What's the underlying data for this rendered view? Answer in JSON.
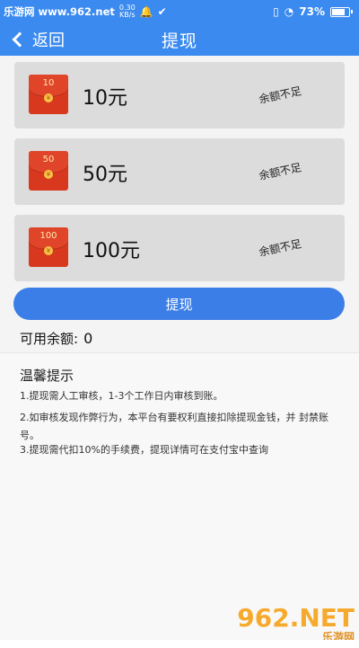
{
  "status_bar": {
    "watermark": "乐游网 www.962.net",
    "speed_value": "0.30",
    "speed_unit": "KB/s",
    "battery": "73%"
  },
  "header": {
    "back_label": "返回",
    "title": "提现"
  },
  "options": [
    {
      "packet_value": "10",
      "amount": "10元",
      "status": "余额不足"
    },
    {
      "packet_value": "50",
      "amount": "50元",
      "status": "余额不足"
    },
    {
      "packet_value": "100",
      "amount": "100元",
      "status": "余额不足"
    }
  ],
  "withdraw_button": "提现",
  "balance": {
    "label": "可用余额:",
    "value": "0"
  },
  "tips": {
    "title": "温馨提示",
    "items": [
      "1.提现需人工审核，1-3个工作日内审核到账。",
      "2.如审核发现作弊行为，本平台有要权利直接扣除提现金钱，并 封禁账号。",
      "3.提现需代扣10%的手续费，提现详情可在支付宝中查询"
    ]
  },
  "watermark_logo": {
    "big": "962.NET",
    "small": "乐游网"
  },
  "colors": {
    "primary": "#3b8af0",
    "button": "#3b7ee8",
    "packet": "#d8381e"
  }
}
